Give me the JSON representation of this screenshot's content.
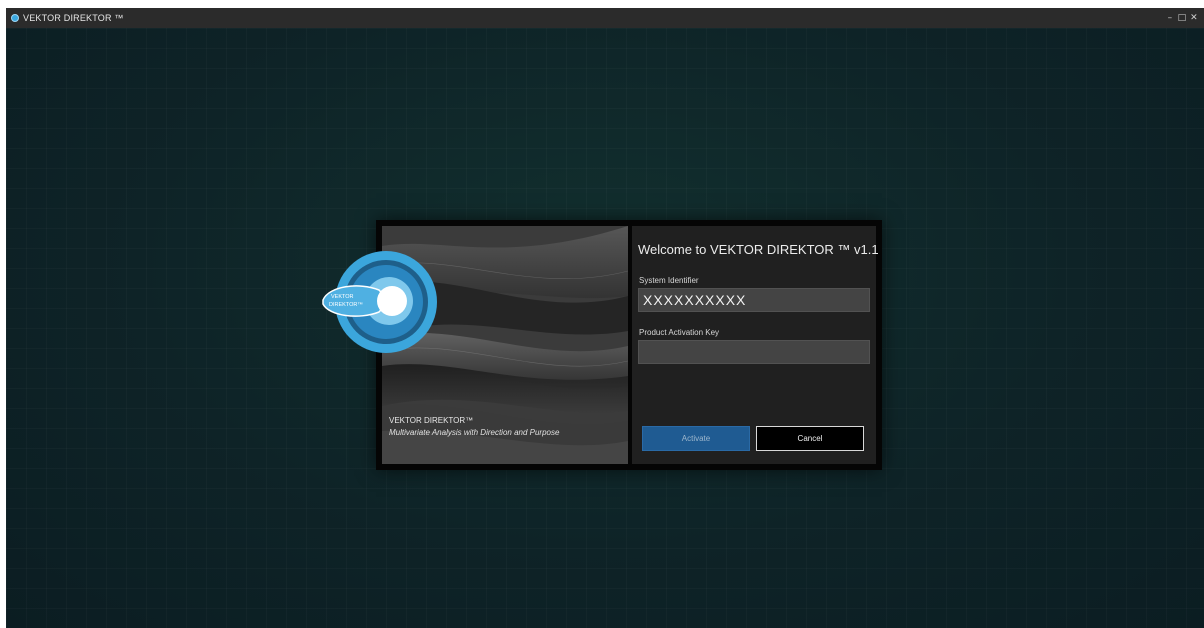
{
  "window": {
    "title": "VEKTOR DIREKTOR ™",
    "controls": {
      "minimize": "–",
      "maximize": "□",
      "close": "✕"
    }
  },
  "logo": {
    "text_line1": "VEKTOR",
    "text_line2": "DIREKTOR™",
    "colors": {
      "outer_ring": "#3ba6dc",
      "inner_ring": "#2a86c0",
      "core": "#ffffff"
    }
  },
  "dialog": {
    "splash": {
      "product_name": "VEKTOR DIREKTOR™",
      "tagline": "Multivariate Analysis with Direction and Purpose"
    },
    "form": {
      "welcome": "Welcome to VEKTOR DIREKTOR ™ v1.1",
      "system_identifier_label": "System Identifier",
      "system_identifier_value": "XXXXXXXXXX",
      "activation_key_label": "Product Activation Key",
      "activation_key_value": "",
      "activate_label": "Activate",
      "cancel_label": "Cancel"
    }
  },
  "colors": {
    "workspace_bg": "#0f2126",
    "titlebar_bg": "#2b2b2b",
    "activate_bg": "#1f5b92",
    "form_bg": "#202020"
  }
}
